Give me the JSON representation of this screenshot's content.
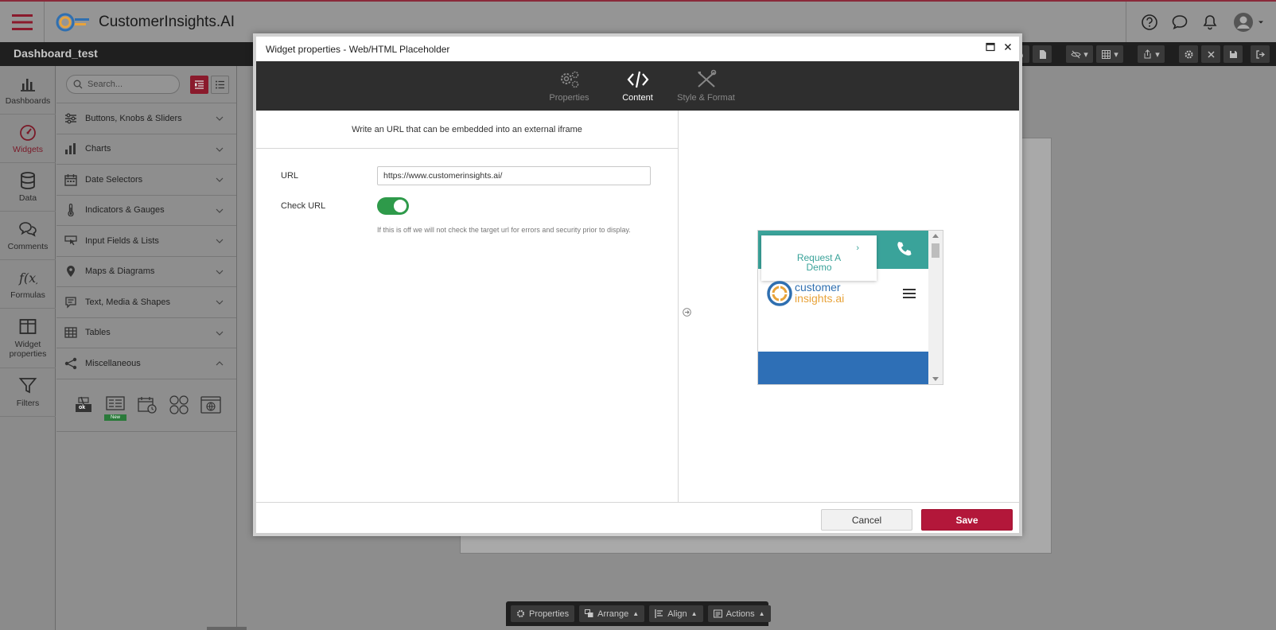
{
  "app": {
    "title": "CustomerInsights.AI",
    "dashboard_name": "Dashboard_test"
  },
  "nav": {
    "items": [
      {
        "label": "Dashboards",
        "icon": "bar-chart-icon"
      },
      {
        "label": "Widgets",
        "icon": "gauge-icon",
        "active": true
      },
      {
        "label": "Data",
        "icon": "database-icon"
      },
      {
        "label": "Comments",
        "icon": "comments-icon"
      },
      {
        "label": "Formulas",
        "icon": "formula-icon"
      },
      {
        "label": "Widget properties",
        "icon": "layout-icon"
      },
      {
        "label": "Filters",
        "icon": "filter-icon"
      }
    ]
  },
  "widgets_panel": {
    "search_placeholder": "Search...",
    "categories": [
      {
        "label": "Buttons, Knobs & Sliders",
        "icon": "sliders-icon"
      },
      {
        "label": "Charts",
        "icon": "chart-icon"
      },
      {
        "label": "Date Selectors",
        "icon": "calendar-icon"
      },
      {
        "label": "Indicators & Gauges",
        "icon": "thermometer-icon"
      },
      {
        "label": "Input Fields & Lists",
        "icon": "pointer-icon"
      },
      {
        "label": "Maps & Diagrams",
        "icon": "map-pin-icon"
      },
      {
        "label": "Text, Media & Shapes",
        "icon": "text-icon"
      },
      {
        "label": "Tables",
        "icon": "table-icon"
      },
      {
        "label": "Miscellaneous",
        "icon": "share-icon",
        "expanded": true
      }
    ],
    "misc_new_badge": "New",
    "misc_ok_label": "ok"
  },
  "modal": {
    "title": "Widget properties - Web/HTML Placeholder",
    "tabs": [
      {
        "label": "Properties",
        "icon": "gears-icon"
      },
      {
        "label": "Content",
        "icon": "code-icon",
        "active": true
      },
      {
        "label": "Style & Format",
        "icon": "tools-icon"
      }
    ],
    "hint": "Write an URL that can be embedded into an external iframe",
    "url_label": "URL",
    "url_value": "https://www.customerinsights.ai/",
    "check_url_label": "Check URL",
    "check_url_on": true,
    "help_text": "If this is off we will not check the target url for errors and security prior to display.",
    "preview": {
      "cta": "Request A Demo",
      "logo_line1": "customer",
      "logo_line2": "insights.ai"
    },
    "cancel_label": "Cancel",
    "save_label": "Save"
  },
  "bottom_toolbar": {
    "properties": "Properties",
    "arrange": "Arrange",
    "align": "Align",
    "actions": "Actions"
  },
  "colors": {
    "accent": "#b3173a",
    "toggle_on": "#2e9a4a",
    "teal": "#3aa39a",
    "brand_blue": "#2e6fb6"
  }
}
